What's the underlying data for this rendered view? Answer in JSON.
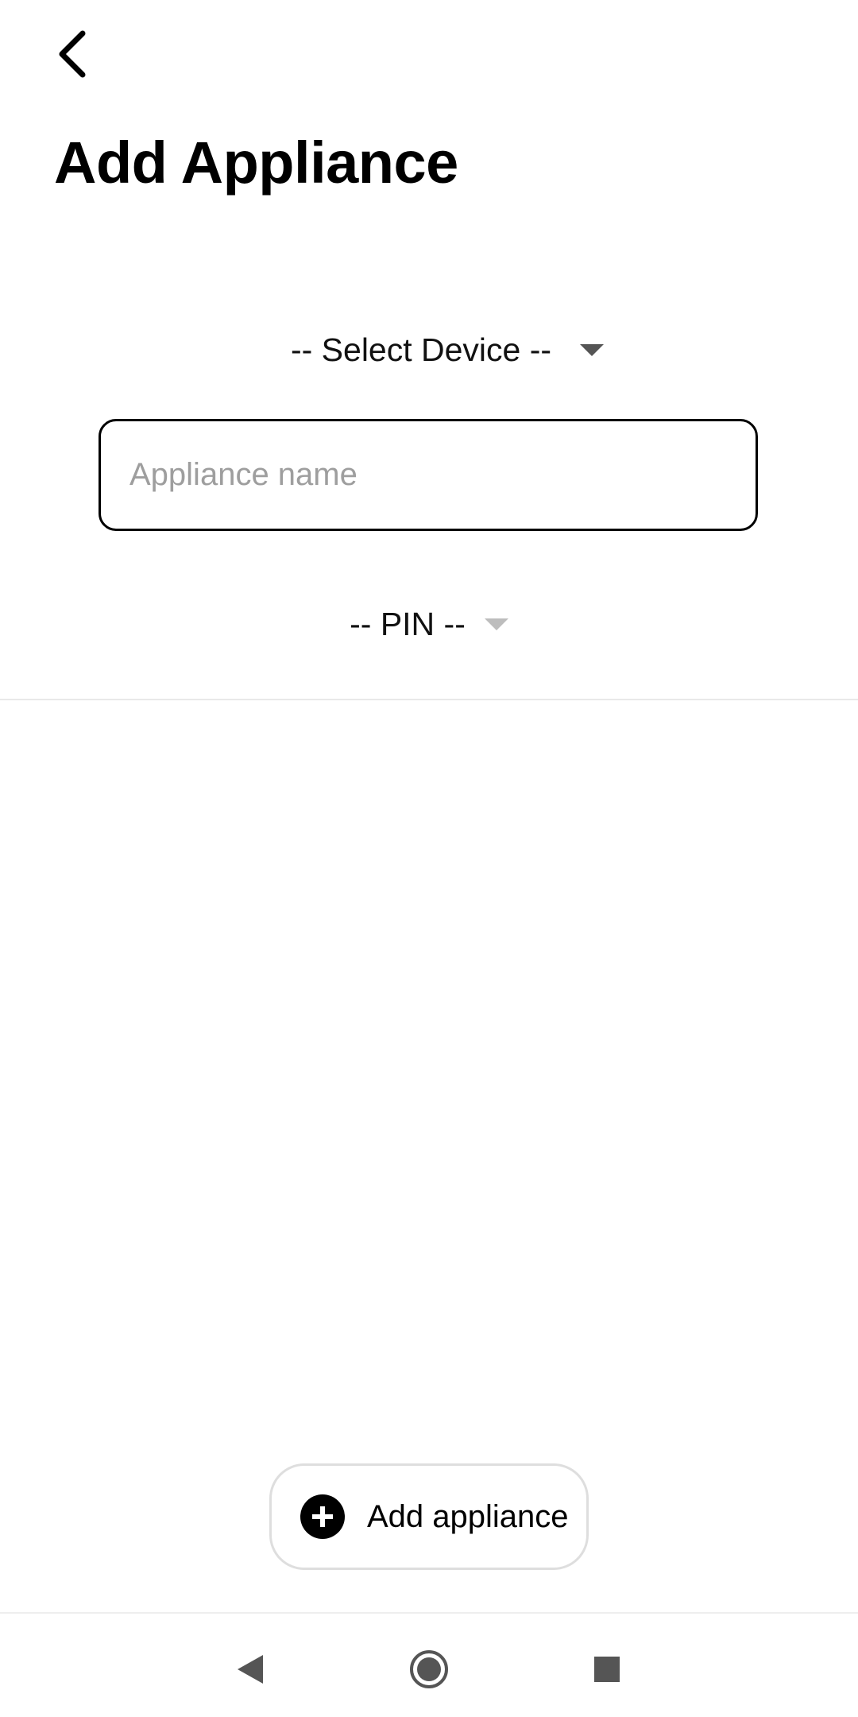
{
  "header": {
    "back_icon": "chevron-left-icon",
    "title": "Add Appliance"
  },
  "form": {
    "device_select": {
      "label": "-- Select Device --",
      "icon": "caret-down-icon"
    },
    "name_input": {
      "value": "",
      "placeholder": "Appliance name"
    },
    "pin_select": {
      "label": "-- PIN --",
      "icon": "caret-down-icon"
    }
  },
  "actions": {
    "add_button": {
      "label": "Add appliance",
      "icon": "plus-circle-icon"
    }
  },
  "system_nav": {
    "back_icon": "nav-back-icon",
    "home_icon": "nav-home-icon",
    "recents_icon": "nav-recents-icon"
  },
  "colors": {
    "background": "#ffffff",
    "text": "#000000",
    "placeholder": "#9e9e9e",
    "divider": "#e9e9e9",
    "nav_icon": "#555555",
    "disabled_caret": "#bdbdbd"
  }
}
